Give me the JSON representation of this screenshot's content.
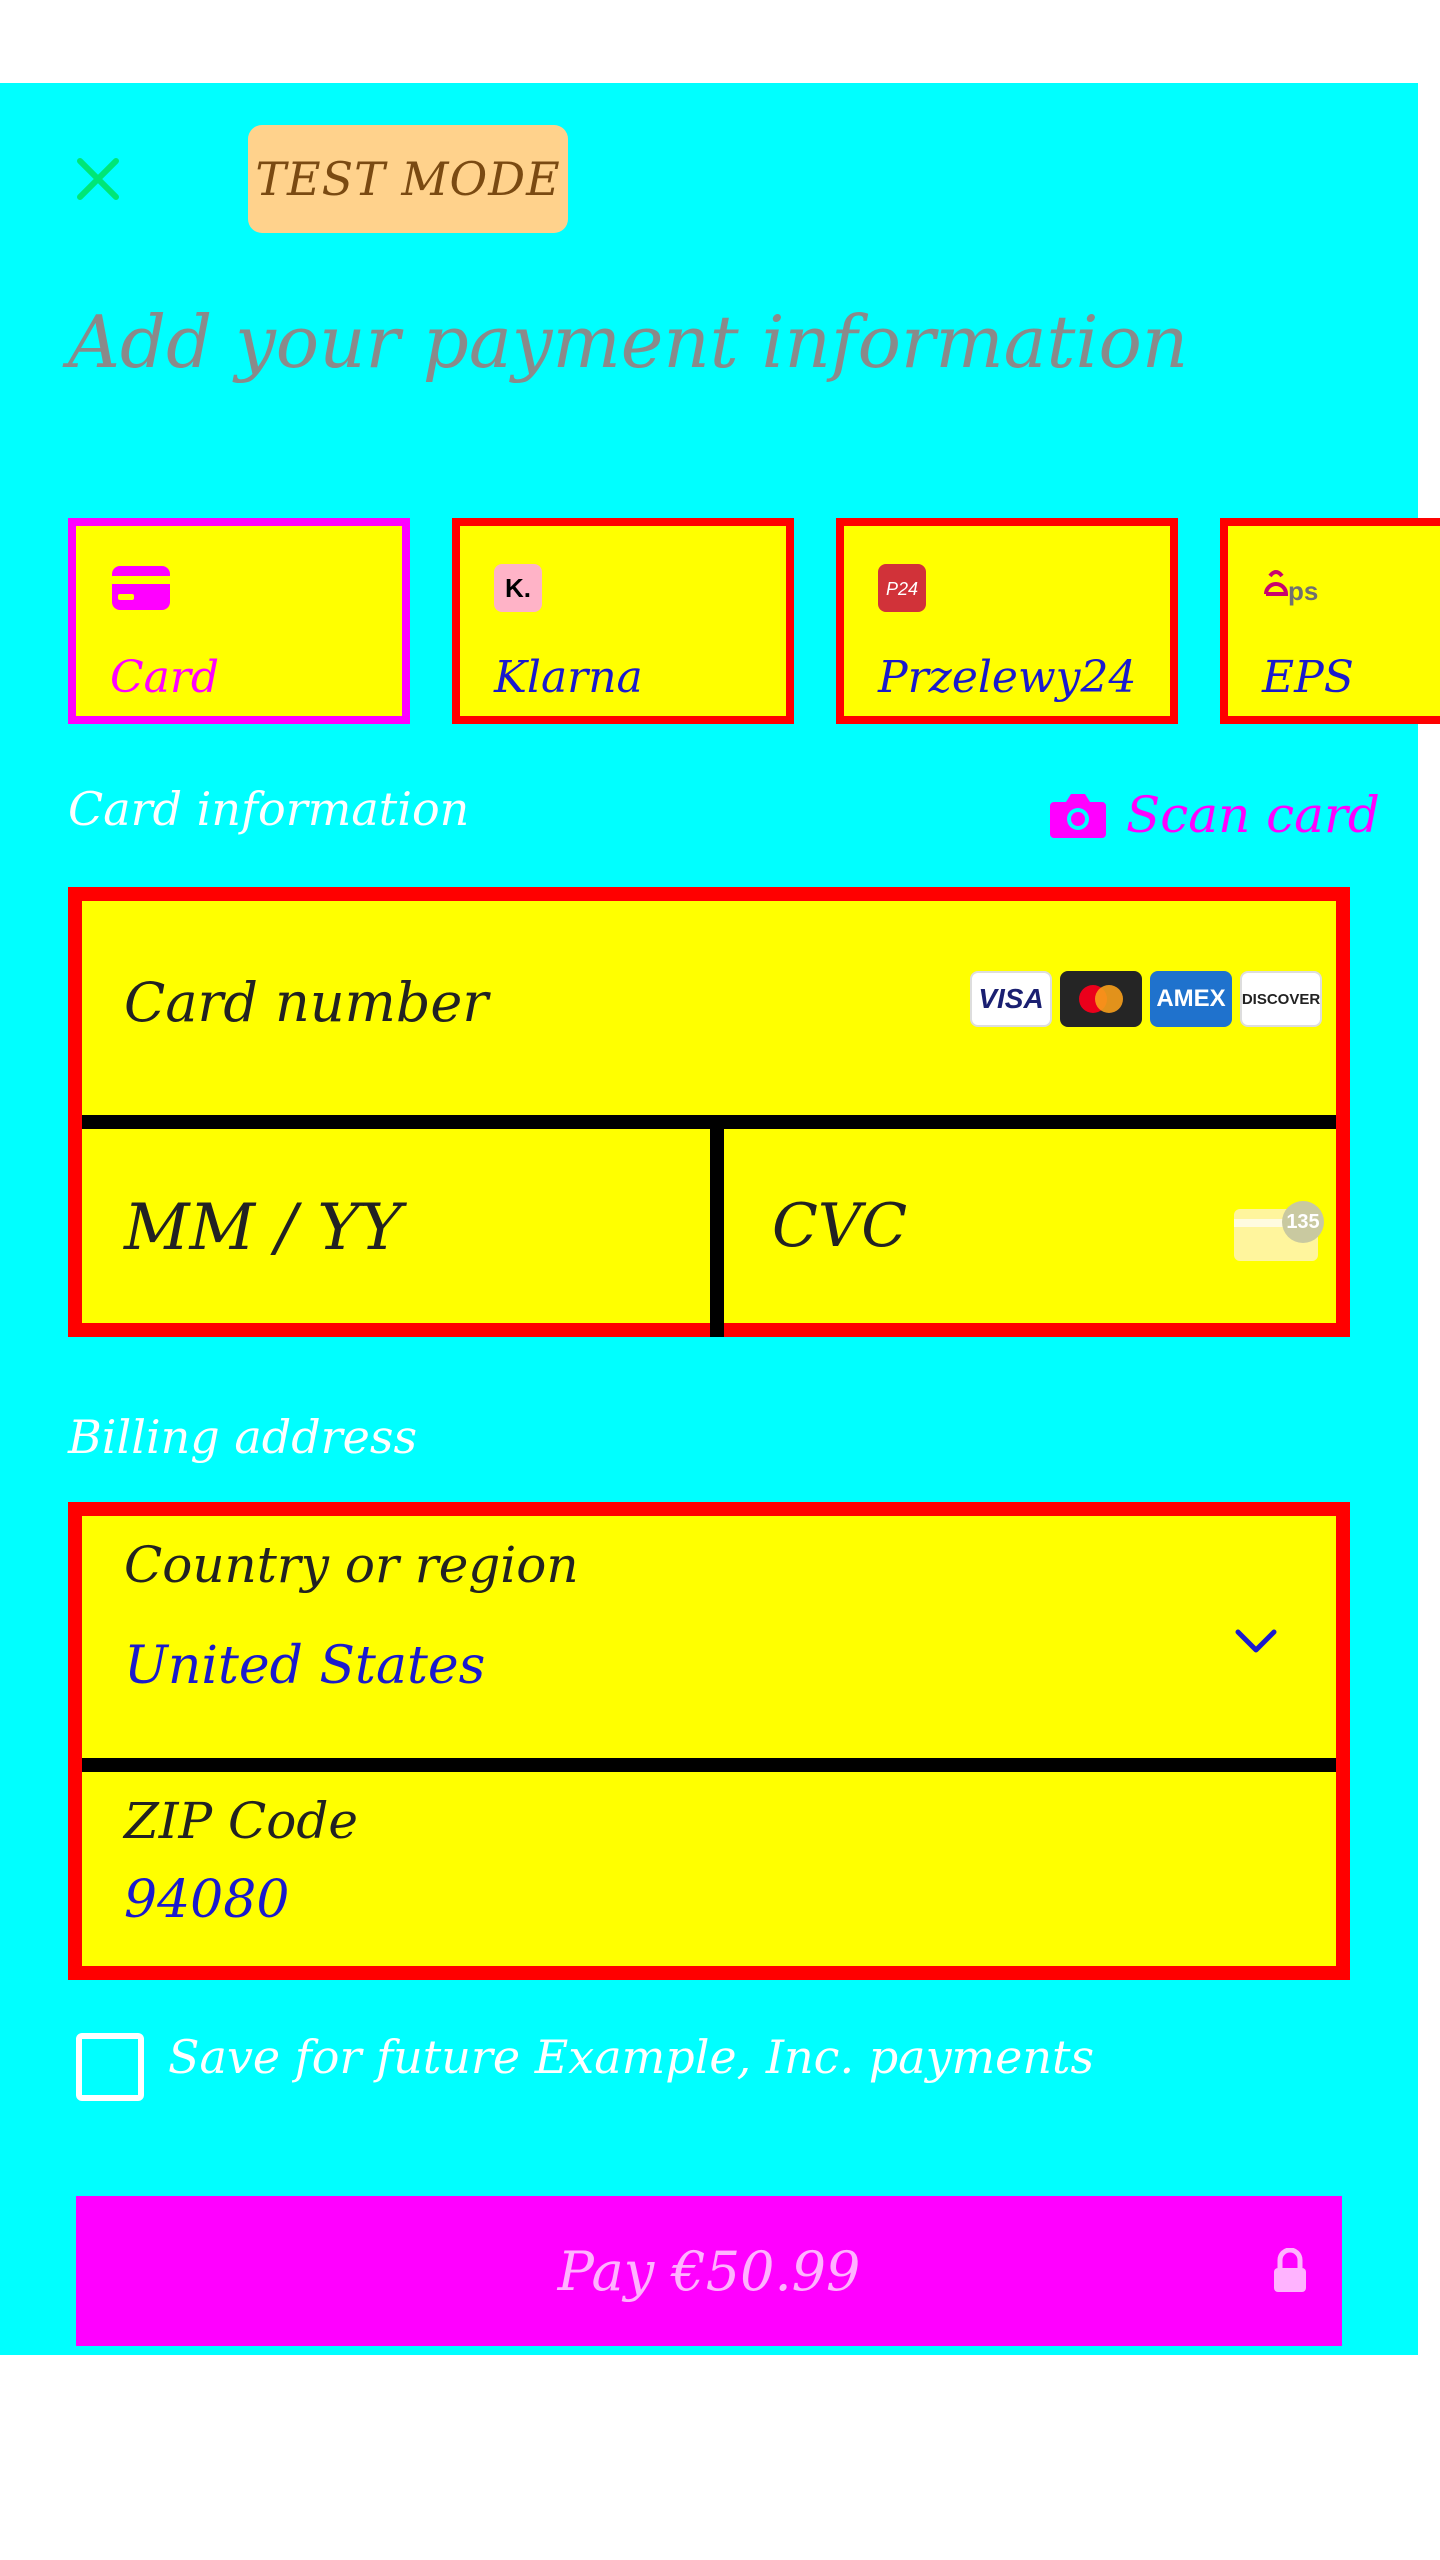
{
  "header": {
    "close_icon": "close-icon",
    "test_mode_badge": "TEST MODE"
  },
  "title": "Add your payment information",
  "payment_tabs": [
    {
      "label": "Card",
      "icon": "credit-card-icon",
      "selected": true
    },
    {
      "label": "Klarna",
      "icon": "klarna-logo",
      "selected": false
    },
    {
      "label": "Przelewy24",
      "icon": "p24-logo",
      "selected": false
    },
    {
      "label": "EPS",
      "icon": "eps-logo",
      "selected": false
    }
  ],
  "card_info": {
    "section_label": "Card information",
    "scan_card_label": "Scan card",
    "card_number_placeholder": "Card number",
    "expiry_placeholder": "MM / YY",
    "cvc_placeholder": "CVC",
    "cvc_badge": "135",
    "brands": [
      "VISA",
      "mastercard",
      "AMEX",
      "DISCOVER"
    ]
  },
  "billing": {
    "section_label": "Billing address",
    "country_label": "Country or region",
    "country_value": "United States",
    "zip_label": "ZIP Code",
    "zip_value": "94080"
  },
  "save_label": "Save for future Example, Inc. payments",
  "pay_button": {
    "label": "Pay €50.99",
    "icon": "lock-icon"
  },
  "colors": {
    "background": "#00ffff",
    "field_fill": "#ffff00",
    "field_border": "#ff0000",
    "accent": "#ff00ff"
  }
}
